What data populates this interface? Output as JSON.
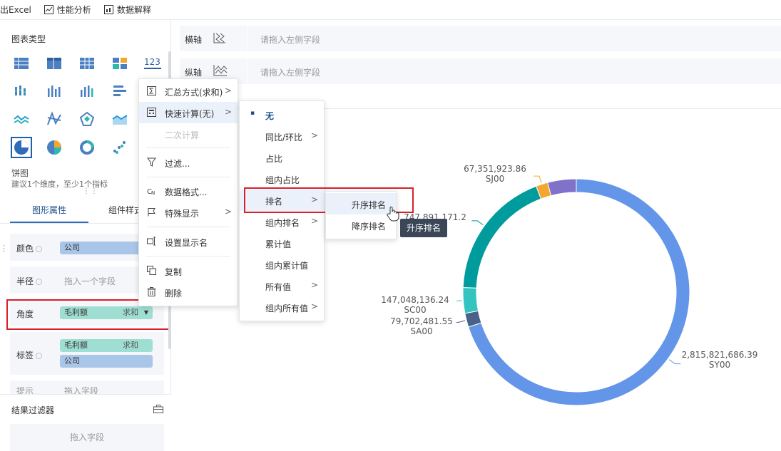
{
  "toolbar": {
    "export_excel": "出Excel",
    "perf_analysis": "性能分析",
    "data_explain": "数据解释"
  },
  "left": {
    "chart_type_title": "图表类型",
    "chart_type_number_label": "123",
    "selected_chart_name": "饼图",
    "selected_chart_hint": "建议1个维度，至少1个指标",
    "tab_graph": "图形属性",
    "tab_component": "组件样式",
    "props": {
      "color_label": "颜色",
      "color_chip": "公司",
      "radius_label": "半径",
      "radius_placeholder": "拖入一个字段",
      "angle_label": "角度",
      "angle_chip": "毛利额",
      "angle_agg": "求和",
      "tag_label": "标签",
      "tag_chip1": "毛利额",
      "tag_chip1_agg": "求和",
      "tag_chip2": "公司",
      "hint_label": "提示",
      "hint_placeholder": "拖入字段"
    },
    "filter_title": "结果过滤器",
    "filter_placeholder": "拖入字段"
  },
  "axes": {
    "x_label": "横轴",
    "x_placeholder": "请拖入左侧字段",
    "y_label": "纵轴",
    "y_placeholder": "请拖入左侧字段"
  },
  "context_menu": {
    "items": [
      {
        "label": "汇总方式(求和)",
        "arrow": ">"
      },
      {
        "label": "快速计算(无)",
        "arrow": ">"
      },
      {
        "label": "二次计算"
      },
      {
        "label": "过滤..."
      },
      {
        "label": "数据格式..."
      },
      {
        "label": "特殊显示",
        "arrow": ">"
      },
      {
        "label": "设置显示名"
      },
      {
        "label": "复制"
      },
      {
        "label": "删除"
      }
    ]
  },
  "quick_calc_menu": {
    "items": [
      {
        "label": "无",
        "bullet": "▪"
      },
      {
        "label": "同比/环比",
        "arrow": ">"
      },
      {
        "label": "占比"
      },
      {
        "label": "组内占比"
      },
      {
        "label": "排名",
        "arrow": ">"
      },
      {
        "label": "组内排名",
        "arrow": ">"
      },
      {
        "label": "累计值"
      },
      {
        "label": "组内累计值"
      },
      {
        "label": "所有值",
        "arrow": ">"
      },
      {
        "label": "组内所有值",
        "arrow": ">"
      }
    ]
  },
  "rank_menu": {
    "items": [
      {
        "label": "升序排名"
      },
      {
        "label": "降序排名"
      }
    ]
  },
  "tooltip": "升序排名",
  "chart_data": {
    "type": "pie",
    "variant": "donut",
    "slices": [
      {
        "name": "SY00",
        "value": 2815821686.39,
        "label": "2,815,821,686.39",
        "color": "#6396e9"
      },
      {
        "name": "SA00",
        "value": 79702481.55,
        "label": "79,702,481.55",
        "color": "#4a6288"
      },
      {
        "name": "SC00",
        "value": 147048136.24,
        "label": "147,048,136.24",
        "color": "#34c4bf"
      },
      {
        "name": "",
        "value": 747891171.2,
        "label": "747,891,171.2",
        "color": "#009b9d"
      },
      {
        "name": "SJ00",
        "value": 67351923.86,
        "label": "67,351,923.86",
        "color": "#f5a62e"
      },
      {
        "name": "",
        "value": 164000000,
        "label": "",
        "color": "#8072c9"
      }
    ]
  },
  "colors": {
    "highlight_red": "#d9202a",
    "accent_blue": "#2e6bb8",
    "menu_highlight": "#eaf1fb"
  }
}
